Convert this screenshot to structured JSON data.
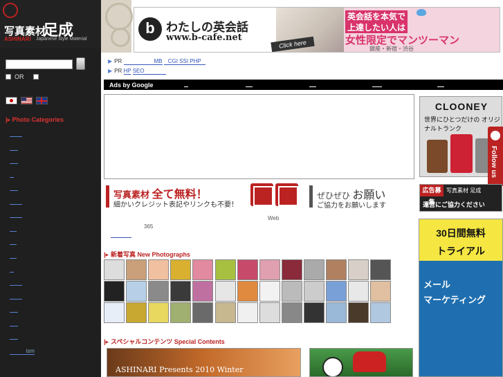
{
  "sidebar": {
    "logo_jp": "写真素材",
    "logo_big": "足成",
    "logo_en_red": "ASHINARI",
    "logo_en_sub": "Japanese style Material",
    "search": {
      "value": "",
      "button_label": ""
    },
    "or_label": "OR",
    "categories_heading": "Photo Categories",
    "ism_label": "ism"
  },
  "banner": {
    "logo_letter": "b",
    "title": "わたしの英会話",
    "url": "www.b-cafe.net",
    "click": "Click here",
    "line1": "英会話を本気で",
    "line2": "上達したい人は",
    "line3": "女性限定でマンツーマン",
    "locations": "銀座・新宿・渋谷"
  },
  "pr": {
    "row1": {
      "prefix": "PR",
      "link_mid": "MB",
      "link_end": "CGI SSI PHP"
    },
    "row2": {
      "prefix": "PR",
      "link_a": "HP",
      "link_b": "SEO"
    }
  },
  "ads": {
    "label": "Ads by Google"
  },
  "promo": {
    "free_prefix": "写真素材 ",
    "free_highlight": "全て無料！",
    "free_sub": "細かいクレジット表記やリンクも不要！",
    "please_prefix": "ぜひぜひ ",
    "please_highlight": "お願い",
    "please_sub": "ご協力をお願いします"
  },
  "misc": {
    "web": "Web",
    "days": "365"
  },
  "sections": {
    "new_photos": "新着写真  New Photographs",
    "special": "スペシャルコンテンツ   Special Contents"
  },
  "special_contents": {
    "item1_line1": "ASHINARI Presents 2010 Winter",
    "item1_line2": "..."
  },
  "right": {
    "clooney_name": "CLOONEY",
    "clooney_sub": "世界にひとつだけの オリジナルトランク",
    "follow": "Follow us",
    "recruit_tag": "広告募集",
    "recruit_right": "写真素材 足成",
    "recruit_line2": "運営にご協力ください",
    "trial_line1": "30日間無料",
    "trial_line2": "トライアル",
    "trial_body1": "メール",
    "trial_body2": "マーケティング"
  },
  "colors": {
    "accent_red": "#bb2222",
    "sidebar_bg": "#1f1f1f",
    "link_blue": "#3355bb",
    "trial_yellow": "#f5e642",
    "trial_blue": "#1f6fb0"
  },
  "thumb_colors": [
    "#ddd",
    "#c9a07a",
    "#f0c0a0",
    "#d9b030",
    "#e28aa0",
    "#a8c040",
    "#c84a6a",
    "#e0a0b0",
    "#8a2a3a",
    "#aaa",
    "#b08060",
    "#d8d0c8",
    "#555",
    "#222",
    "#b7d0e8",
    "#8a8a8a",
    "#3a3a3a",
    "#c070a0",
    "#e6e6e6",
    "#e08a40",
    "#f2f2f2",
    "#bbb",
    "#ccc",
    "#7aa0d8",
    "#e8e8e8",
    "#e0c0a0",
    "#e8eef8",
    "#c8a830",
    "#e8d860",
    "#a0b070",
    "#6a6a6a",
    "#c8b890",
    "#f0f0f0",
    "#ddd",
    "#888",
    "#333",
    "#9ab8d8",
    "#4a3a2a",
    "#b0c8e0"
  ]
}
